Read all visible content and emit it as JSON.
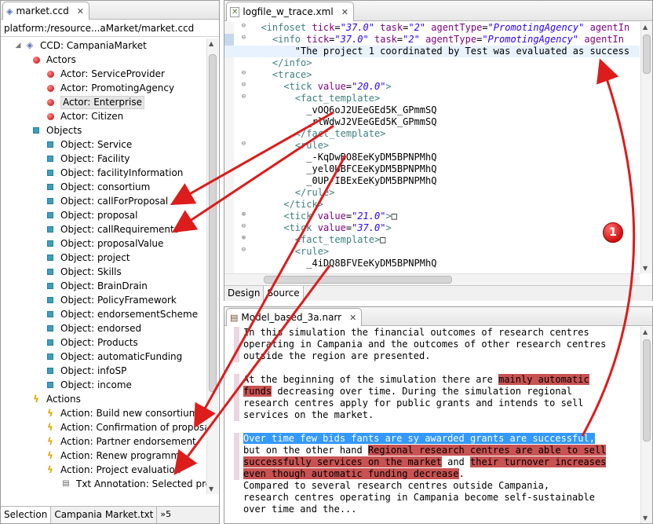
{
  "left_panel": {
    "tab_title": "market.ccd",
    "path": "platform:/resource...aMarket/market.ccd",
    "tree": {
      "root": "CCD: CampaniaMarket",
      "actors_label": "Actors",
      "actors": [
        "Actor: ServiceProvider",
        "Actor: PromotingAgency",
        "Actor: Enterprise",
        "Actor: Citizen"
      ],
      "objects_label": "Objects",
      "objects": [
        "Object: Service",
        "Object: Facility",
        "Object: facilityInformation",
        "Object: consortium",
        "Object: callForProposal",
        "Object: proposal",
        "Object: callRequirements",
        "Object: proposalValue",
        "Object: project",
        "Object: Skills",
        "Object: BrainDrain",
        "Object: PolicyFramework",
        "Object: endorsementScheme",
        "Object: endorsed",
        "Object: Products",
        "Object: automaticFunding",
        "Object: infoSP",
        "Object: income"
      ],
      "actions_label": "Actions",
      "actions": [
        "Action: Build new consortium",
        "Action: Confirmation of proposal",
        "Action: Partner endorsement",
        "Action: Renew programme",
        "Action: Project evaluation"
      ],
      "annotation": "Txt Annotation: Selected prop"
    },
    "bottom_tabs": [
      "Selection",
      "Campania Market.txt",
      "»5"
    ]
  },
  "xml_editor": {
    "tab_title": "logfile_w_trace.xml",
    "lines": [
      {
        "indent": "  ",
        "parts": [
          [
            "tg",
            "<infoset "
          ],
          [
            "an",
            "tick"
          ],
          [
            "t",
            "="
          ],
          [
            "av",
            "\"37.0\""
          ],
          [
            "t",
            " "
          ],
          [
            "an",
            "task"
          ],
          [
            "t",
            "="
          ],
          [
            "av",
            "\"2\""
          ],
          [
            "t",
            " "
          ],
          [
            "an",
            "agentType"
          ],
          [
            "t",
            "="
          ],
          [
            "av",
            "\"PromotingAgency\""
          ],
          [
            "t",
            " "
          ],
          [
            "an",
            "agentIn"
          ]
        ],
        "fold": "minus"
      },
      {
        "indent": "    ",
        "parts": [
          [
            "tg",
            "<info "
          ],
          [
            "an",
            "tick"
          ],
          [
            "t",
            "="
          ],
          [
            "av",
            "\"37.0\""
          ],
          [
            "t",
            " "
          ],
          [
            "an",
            "task"
          ],
          [
            "t",
            "="
          ],
          [
            "av",
            "\"2\""
          ],
          [
            "t",
            " "
          ],
          [
            "an",
            "agentType"
          ],
          [
            "t",
            "="
          ],
          [
            "av",
            "\"PromotingAgency\""
          ],
          [
            "t",
            " "
          ],
          [
            "an",
            "agentIn"
          ]
        ],
        "fold": "minus"
      },
      {
        "indent": "        ",
        "parts": [
          [
            "t",
            "\"The project 1 coordinated by Test was evaluated as success"
          ]
        ],
        "highlight": true
      },
      {
        "indent": "    ",
        "parts": [
          [
            "tg",
            "</info>"
          ]
        ]
      },
      {
        "indent": "    ",
        "parts": [
          [
            "tg",
            "<trace>"
          ]
        ],
        "fold": "minus"
      },
      {
        "indent": "      ",
        "parts": [
          [
            "tg",
            "<tick "
          ],
          [
            "an",
            "value"
          ],
          [
            "t",
            "="
          ],
          [
            "av",
            "\"20.0\""
          ],
          [
            "tg",
            ">"
          ]
        ],
        "fold": "minus"
      },
      {
        "indent": "        ",
        "parts": [
          [
            "tg",
            "<fact_template>"
          ]
        ],
        "fold": "minus"
      },
      {
        "indent": "          ",
        "parts": [
          [
            "t",
            "_vOQ6oJ2UEeGEd5K_GPmmSQ"
          ]
        ]
      },
      {
        "indent": "          ",
        "parts": [
          [
            "t",
            "_rlWdwJ2VEeGEd5K_GPmmSQ"
          ]
        ]
      },
      {
        "indent": "        ",
        "parts": [
          [
            "tg",
            "</fact_template>"
          ]
        ]
      },
      {
        "indent": "        ",
        "parts": [
          [
            "tg",
            "<rule>"
          ]
        ],
        "fold": "minus"
      },
      {
        "indent": "          ",
        "parts": [
          [
            "t",
            "_-KqDwBO8EeKyDM5BPNPMhQ"
          ]
        ]
      },
      {
        "indent": "          ",
        "parts": [
          [
            "t",
            "_yel0UBFCEeKyDM5BPNPMhQ"
          ]
        ]
      },
      {
        "indent": "          ",
        "parts": [
          [
            "t",
            "_0UP-IBExEeKyDM5BPNPMhQ"
          ]
        ]
      },
      {
        "indent": "        ",
        "parts": [
          [
            "tg",
            "</rule>"
          ]
        ]
      },
      {
        "indent": "      ",
        "parts": [
          [
            "tg",
            "</tick>"
          ]
        ]
      },
      {
        "indent": "      ",
        "parts": [
          [
            "tg",
            "<tick "
          ],
          [
            "an",
            "value"
          ],
          [
            "t",
            "="
          ],
          [
            "av",
            "\"21.0\""
          ],
          [
            "tg",
            ">"
          ],
          [
            "t",
            "□"
          ]
        ],
        "fold": "plus"
      },
      {
        "indent": "      ",
        "parts": [
          [
            "tg",
            "<tick "
          ],
          [
            "an",
            "value"
          ],
          [
            "t",
            "="
          ],
          [
            "av",
            "\"37.0\""
          ],
          [
            "tg",
            ">"
          ]
        ],
        "fold": "minus"
      },
      {
        "indent": "        ",
        "parts": [
          [
            "tg",
            "<fact_template>"
          ],
          [
            "t",
            "□"
          ]
        ],
        "fold": "plus"
      },
      {
        "indent": "        ",
        "parts": [
          [
            "tg",
            "<rule>"
          ]
        ],
        "fold": "minus"
      },
      {
        "indent": "          ",
        "parts": [
          [
            "t",
            "_4iDQ8BFVEeKyDM5BPNPMhQ"
          ]
        ]
      }
    ],
    "sub_tabs": [
      "Design",
      "Source"
    ],
    "active_sub_tab": "Source"
  },
  "narrative_editor": {
    "tab_title": "Model_based_3a.narr",
    "lines": [
      {
        "bar": true,
        "parts": [
          [
            "t",
            "In this simulation the financial outcomes of research centres"
          ]
        ]
      },
      {
        "bar": true,
        "parts": [
          [
            "t",
            "operating in Campania and the outcomes of other research centres"
          ]
        ]
      },
      {
        "bar": true,
        "parts": [
          [
            "t",
            "outside the region are presented."
          ]
        ]
      },
      {
        "bar": false,
        "parts": [
          [
            "t",
            ""
          ]
        ]
      },
      {
        "bar": true,
        "parts": [
          [
            "t",
            "At the beginning of the simulation there are "
          ],
          [
            "red",
            "mainly automatic"
          ]
        ]
      },
      {
        "bar": true,
        "parts": [
          [
            "red",
            "funds"
          ],
          [
            "t",
            " decreasing over time. During the simulation regional"
          ]
        ]
      },
      {
        "bar": true,
        "parts": [
          [
            "t",
            "research centres apply for public grants and intends to sell"
          ]
        ]
      },
      {
        "bar": true,
        "parts": [
          [
            "t",
            "services on the market."
          ]
        ]
      },
      {
        "bar": false,
        "parts": [
          [
            "t",
            ""
          ]
        ]
      },
      {
        "bar": true,
        "parts": [
          [
            "blue",
            "Over time few bids fants are sy awarded grants are successful,"
          ]
        ]
      },
      {
        "bar": true,
        "parts": [
          [
            "t",
            "but on the other hand "
          ],
          [
            "red",
            "Regional research centres are able to sell"
          ]
        ]
      },
      {
        "bar": true,
        "parts": [
          [
            "red",
            "successfully services on the market"
          ],
          [
            "t",
            " and "
          ],
          [
            "red",
            "their turnover increases"
          ]
        ]
      },
      {
        "bar": true,
        "parts": [
          [
            "red",
            "even though automatic funding decrease"
          ],
          [
            "t",
            "."
          ]
        ]
      },
      {
        "bar": false,
        "parts": [
          [
            "t",
            "Compared to several research centres outside Campania,"
          ]
        ]
      },
      {
        "bar": false,
        "parts": [
          [
            "t",
            "research centres operating in Campania become self-sustainable"
          ]
        ]
      },
      {
        "bar": false,
        "parts": [
          [
            "t",
            "over time and the..."
          ]
        ]
      }
    ]
  },
  "annotation_badge": "1",
  "colors": {
    "tag": "#3f7f7f",
    "attr_name": "#7f007f",
    "attr_value": "#2a00ff",
    "highlight_red": "#c95252",
    "selection_blue": "#3399ff",
    "arrow_red": "#dd1c1c"
  }
}
